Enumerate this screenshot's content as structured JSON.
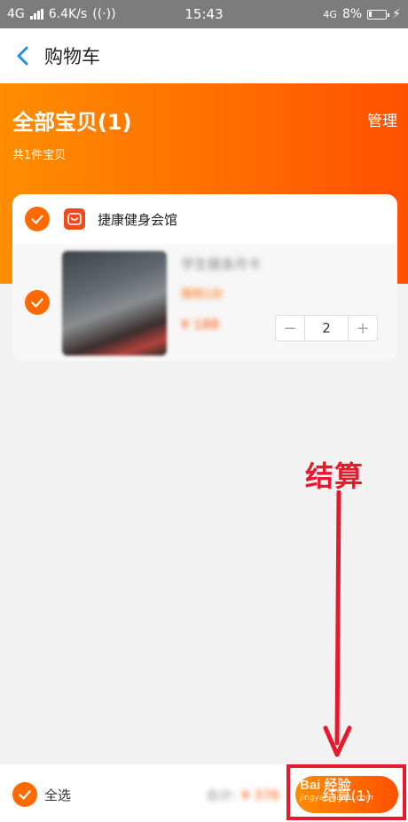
{
  "status_bar": {
    "network": "4G",
    "speed": "6.4K/s",
    "time": "15:43",
    "network_right": "4G",
    "battery": "8%"
  },
  "header": {
    "title": "购物车"
  },
  "banner": {
    "title": "全部宝贝(1)",
    "subtitle": "共1件宝贝",
    "manage": "管理"
  },
  "cart": {
    "shop_name": "捷康健身会馆",
    "items": [
      {
        "name": "学生健身月卡",
        "tag": "限购1份",
        "price": "¥ 188",
        "quantity": "2"
      }
    ]
  },
  "annotation": {
    "text": "结算"
  },
  "footer": {
    "select_all_label": "全选",
    "total_label": "合计:",
    "total_price": "¥ 376",
    "checkout_label": "结算(1)"
  },
  "watermark": {
    "line1": "Bai 经验",
    "line2": "jingyan.baidu.com"
  },
  "colors": {
    "accent": "#ff6a00",
    "annotation": "#e8192c"
  }
}
